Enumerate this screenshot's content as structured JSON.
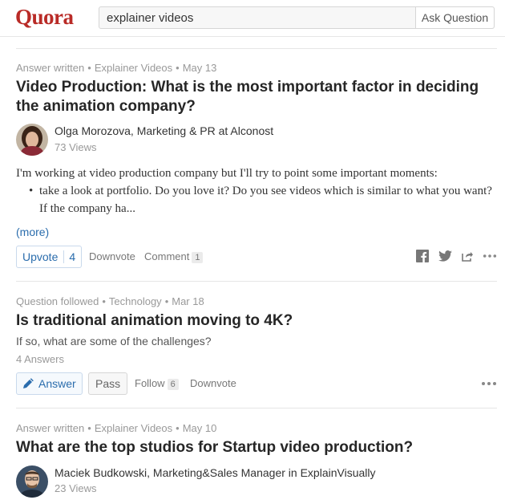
{
  "header": {
    "logo": "Quora",
    "search_value": "explainer videos",
    "ask_label": "Ask Question"
  },
  "feed": {
    "item1": {
      "meta_type": "Answer written",
      "meta_topic": "Explainer Videos",
      "meta_date": "May 13",
      "title": "Video Production: What is the most important factor in deciding the animation company?",
      "author": "Olga Morozova, Marketing & PR at Alconost",
      "views": "73 Views",
      "text": "I'm working at video production company but I'll try to point some important moments:",
      "bullet": "take a look at portfolio. Do you love it? Do you see videos which is similar to what you want? If the company ha...",
      "more": "(more)",
      "upvote_label": "Upvote",
      "upvote_count": "4",
      "downvote_label": "Downvote",
      "comment_label": "Comment",
      "comment_count": "1"
    },
    "item2": {
      "meta_type": "Question followed",
      "meta_topic": "Technology",
      "meta_date": "Mar 18",
      "title": "Is traditional animation moving to 4K?",
      "details": "If so, what are some of the challenges?",
      "answers": "4 Answers",
      "answer_label": "Answer",
      "pass_label": "Pass",
      "follow_label": "Follow",
      "follow_count": "6",
      "downvote_label": "Downvote"
    },
    "item3": {
      "meta_type": "Answer written",
      "meta_topic": "Explainer Videos",
      "meta_date": "May 10",
      "title": "What are the top studios for Startup video production?",
      "author": "Maciek Budkowski, Marketing&Sales Manager in ExplainVisually",
      "views": "23 Views"
    }
  },
  "colors": {
    "brand": "#b92b27",
    "link": "#2b6dad",
    "meta": "#999999"
  },
  "icons": [
    "facebook-icon",
    "twitter-icon",
    "share-icon",
    "more-dots-icon",
    "pencil-icon"
  ]
}
